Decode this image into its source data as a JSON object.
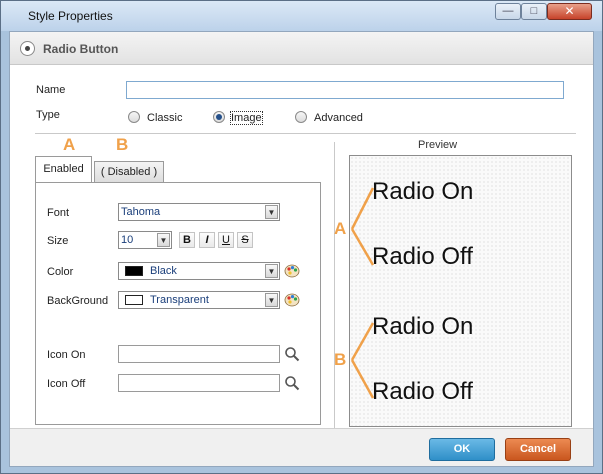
{
  "window": {
    "title": "Style Properties",
    "controls": {
      "minimize": "—",
      "maximize": "□",
      "close": "✕"
    }
  },
  "header": {
    "title": "Radio Button"
  },
  "form": {
    "name_label": "Name",
    "name_value": "",
    "type_label": "Type",
    "type_options": [
      "Classic",
      "Image",
      "Advanced"
    ],
    "type_selected": "Image"
  },
  "annotations": {
    "a": "A",
    "b": "B"
  },
  "tabs": [
    {
      "label": "Enabled",
      "active": true
    },
    {
      "label": "( Disabled )",
      "active": false
    }
  ],
  "props": {
    "font_label": "Font",
    "font_value": "Tahoma",
    "size_label": "Size",
    "size_value": "10",
    "format_buttons": [
      "B",
      "I",
      "U",
      "S"
    ],
    "color_label": "Color",
    "color_value": "Black",
    "color_swatch": "#000000",
    "background_label": "BackGround",
    "background_value": "Transparent",
    "background_swatch": "#ffffff",
    "icon_on_label": "Icon On",
    "icon_off_label": "Icon Off"
  },
  "preview": {
    "title": "Preview",
    "items": [
      "Radio On",
      "Radio Off",
      "Radio On",
      "Radio Off"
    ],
    "group_labels": [
      "A",
      "B"
    ],
    "brace_color": "#f0a14a"
  },
  "footer": {
    "ok_label": "OK",
    "cancel_label": "Cancel"
  },
  "colors": {
    "ok": "#2f8fc8",
    "cancel": "#c9561e",
    "accent": "#f0a14a",
    "titlebar": "#bcd2ea"
  }
}
